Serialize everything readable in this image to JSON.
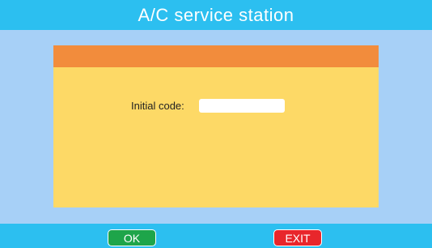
{
  "header": {
    "title": "A/C service station"
  },
  "form": {
    "code_label": "Initial code:",
    "code_value": ""
  },
  "footer": {
    "ok_label": "OK",
    "exit_label": "EXIT"
  },
  "colors": {
    "titlebar": "#2cbff0",
    "background": "#a7d0f7",
    "panel": "#fdd966",
    "panel_header": "#f28c3c",
    "ok": "#1ea54a",
    "exit": "#e8262b"
  }
}
